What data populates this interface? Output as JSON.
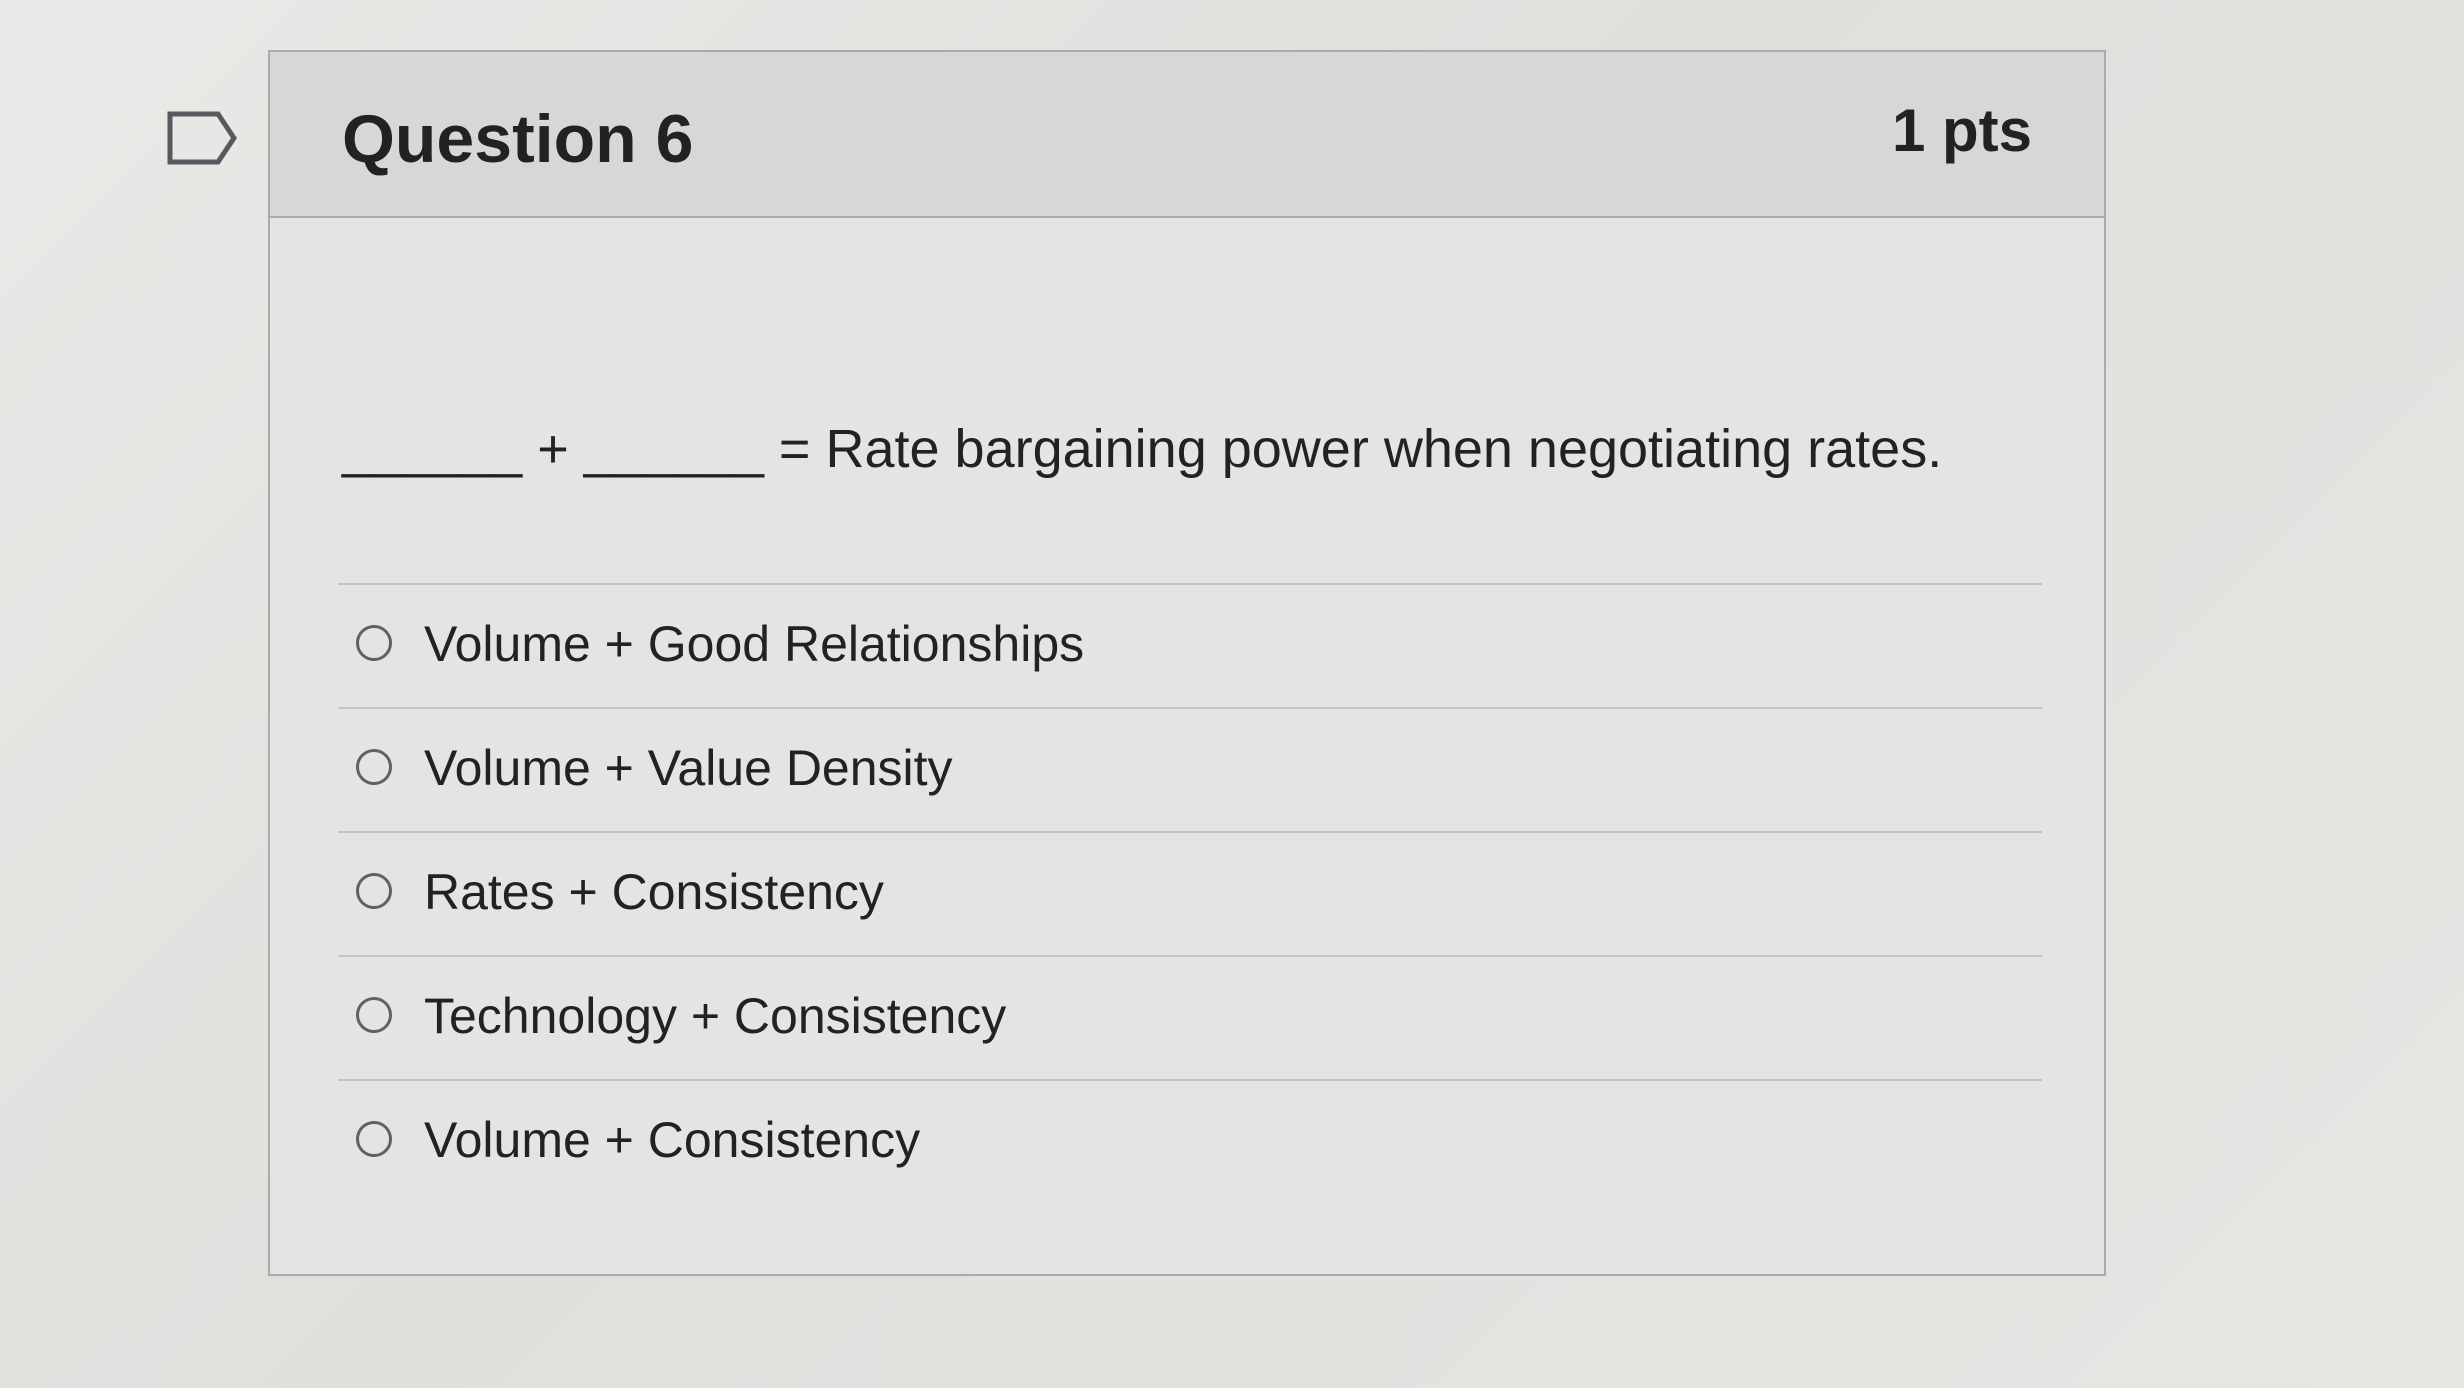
{
  "question": {
    "title": "Question 6",
    "points": "1 pts",
    "text": "______ + ______ = Rate bargaining power when negotiating rates.",
    "flag_icon": "flag-question-icon",
    "answers": [
      {
        "label": "Volume + Good Relationships",
        "selected": false
      },
      {
        "label": "Volume + Value Density",
        "selected": false
      },
      {
        "label": "Rates + Consistency",
        "selected": false
      },
      {
        "label": "Technology + Consistency",
        "selected": false
      },
      {
        "label": "Volume + Consistency",
        "selected": false
      }
    ]
  },
  "colors": {
    "background": "#e3e3e0",
    "header_background": "#d7d8d6",
    "border": "#a9acad",
    "text": "#222222"
  }
}
